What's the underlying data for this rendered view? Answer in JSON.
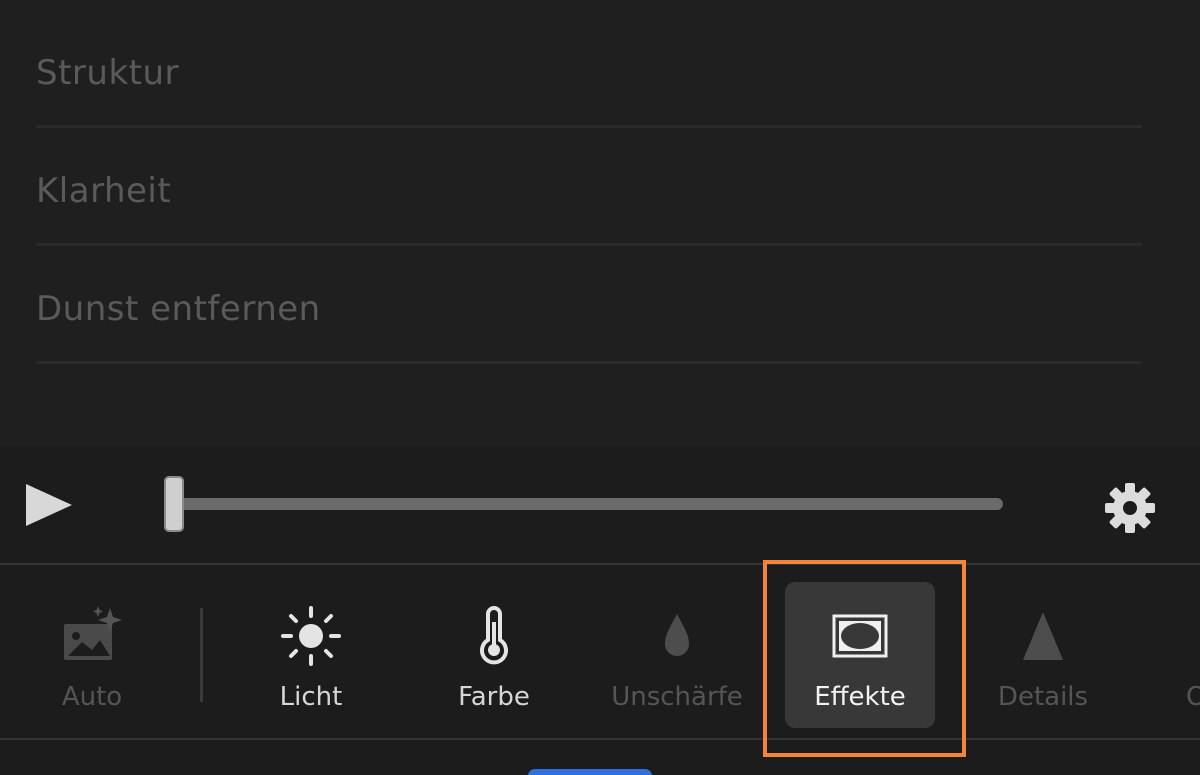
{
  "adjustments": {
    "items": [
      {
        "label": "Struktur"
      },
      {
        "label": "Klarheit"
      },
      {
        "label": "Dunst entfernen"
      }
    ]
  },
  "player": {
    "play_icon": "play-icon",
    "settings_icon": "gear-icon",
    "slider_value": 0
  },
  "toolbar": {
    "tools": [
      {
        "label": "Auto",
        "icon": "auto-enhance-icon",
        "state": "disabled"
      },
      {
        "label": "Licht",
        "icon": "sun-icon",
        "state": "enabled"
      },
      {
        "label": "Farbe",
        "icon": "thermometer-icon",
        "state": "enabled"
      },
      {
        "label": "Unschärfe",
        "icon": "drop-icon",
        "state": "disabled"
      },
      {
        "label": "Effekte",
        "icon": "vignette-icon",
        "state": "selected"
      },
      {
        "label": "Details",
        "icon": "triangle-icon",
        "state": "disabled"
      }
    ],
    "partial_label": "O"
  },
  "colors": {
    "highlight": "#f5853a",
    "accent": "#2f6fe0"
  }
}
